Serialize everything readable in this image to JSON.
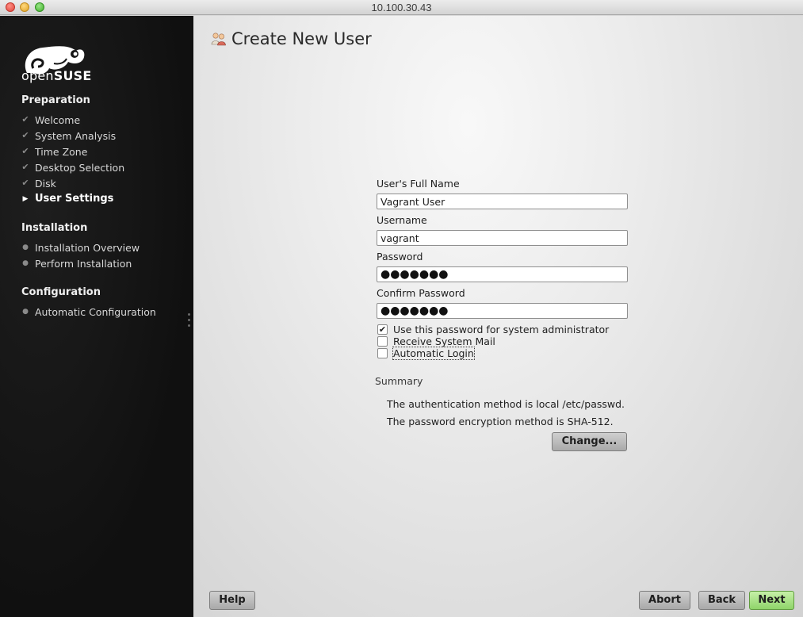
{
  "window": {
    "title": "10.100.30.43"
  },
  "brand": {
    "logo_text_light": "open",
    "logo_text_bold": "SUSE"
  },
  "sidebar": {
    "sections": [
      {
        "title": "Preparation"
      },
      {
        "title": "Installation"
      },
      {
        "title": "Configuration"
      }
    ],
    "steps": [
      {
        "label": "Welcome",
        "state": "done"
      },
      {
        "label": "System Analysis",
        "state": "done"
      },
      {
        "label": "Time Zone",
        "state": "done"
      },
      {
        "label": "Desktop Selection",
        "state": "done"
      },
      {
        "label": "Disk",
        "state": "done"
      },
      {
        "label": "User Settings",
        "state": "current"
      },
      {
        "label": "Installation Overview",
        "state": "pending"
      },
      {
        "label": "Perform Installation",
        "state": "pending"
      },
      {
        "label": "Automatic Configuration",
        "state": "pending"
      }
    ]
  },
  "page": {
    "title": "Create New User"
  },
  "form": {
    "full_name_label": "User's Full Name",
    "full_name_value": "Vagrant User",
    "username_label": "Username",
    "username_value": "vagrant",
    "password_label": "Password",
    "password_mask": "●●●●●●●",
    "confirm_label": "Confirm Password",
    "confirm_mask": "●●●●●●●",
    "options": [
      {
        "label": "Use this password for system administrator",
        "checked": true
      },
      {
        "label": "Receive System Mail",
        "checked": false
      },
      {
        "label": "Automatic Login",
        "checked": false
      }
    ]
  },
  "summary": {
    "title": "Summary",
    "lines": [
      "The authentication method is local /etc/passwd.",
      "The password encryption method is SHA-512."
    ],
    "change_label": "Change..."
  },
  "footer": {
    "help_label": "Help",
    "abort_label": "Abort",
    "back_label": "Back",
    "next_label": "Next"
  },
  "colors": {
    "sidebar_bg": "#141414",
    "next_button": "#a6e07e",
    "check_mark": "#8a8a8a"
  }
}
